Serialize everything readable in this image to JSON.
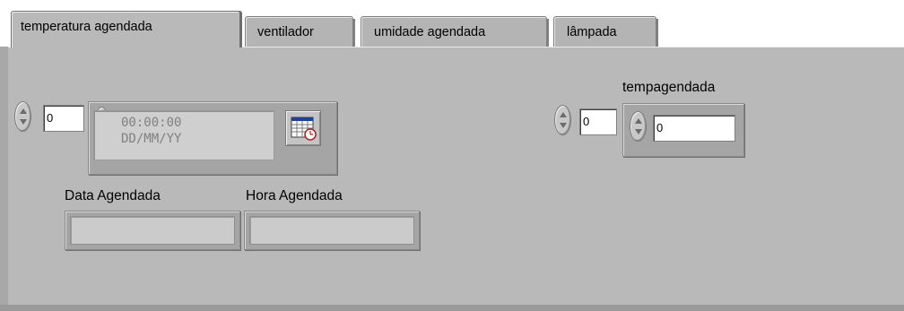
{
  "tabs": [
    {
      "label": "temperatura agendada",
      "active": true
    },
    {
      "label": "ventilador",
      "active": false
    },
    {
      "label": "umidade agendada",
      "active": false
    },
    {
      "label": "lâmpada",
      "active": false
    }
  ],
  "panel": {
    "left_numeric": {
      "value": "0"
    },
    "timestamp": {
      "time": "00:00:00",
      "date": "DD/MM/YY",
      "enabled": false
    },
    "data_agendada": {
      "label": "Data Agendada",
      "value": ""
    },
    "hora_agendada": {
      "label": "Hora Agendada",
      "value": ""
    },
    "right_numeric": {
      "value": "0"
    },
    "tempagendada": {
      "label": "tempagendada",
      "value": "0"
    }
  },
  "icons": {
    "calendar": "calendar-clock-icon",
    "spin": "up-down-arrows-icon"
  },
  "colors": {
    "panel": "#b9b9b9",
    "field": "#ffffff",
    "disabled_field": "#cfcfcf"
  }
}
